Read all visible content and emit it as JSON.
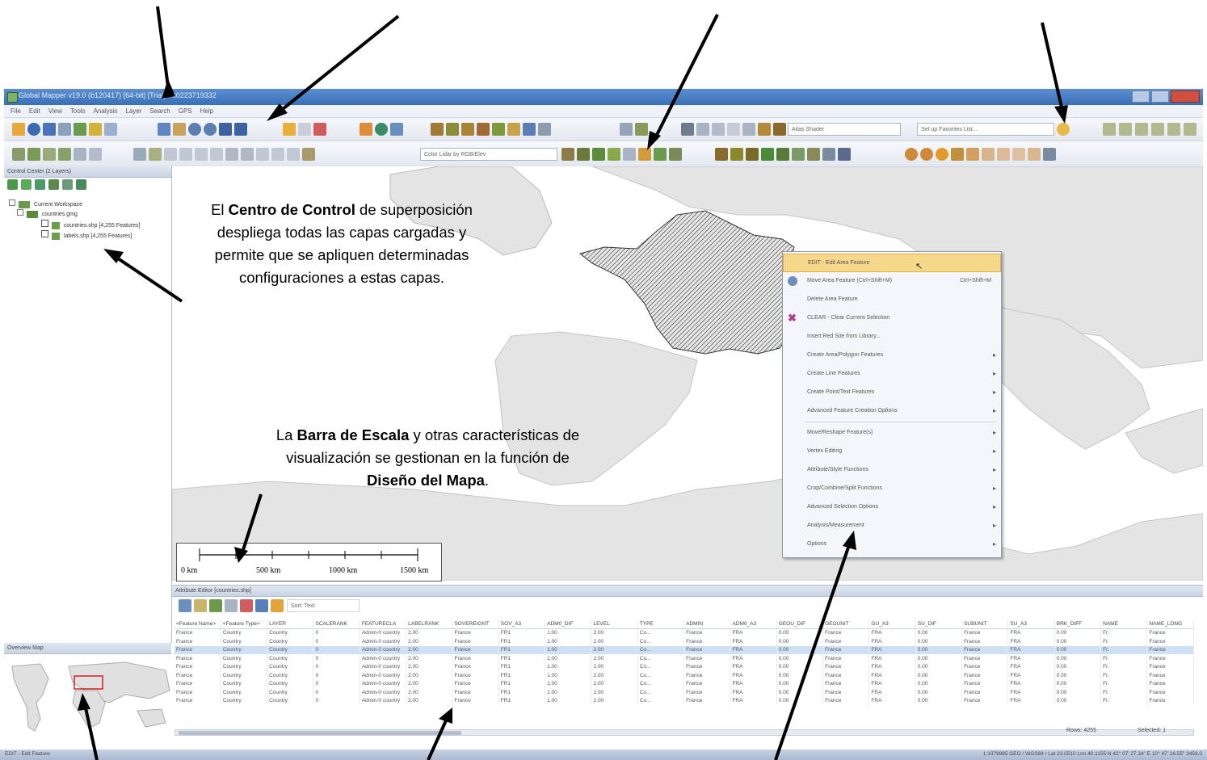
{
  "window": {
    "title": "Global Mapper v19.0 (b120417) [64-bit] [Trial] - 00223719332"
  },
  "menu": [
    "File",
    "Edit",
    "View",
    "Tools",
    "Analysis",
    "Layer",
    "Search",
    "GPS",
    "Help"
  ],
  "toolbars": {
    "shader_combo": "Atlas Shader",
    "favorites_combo": "Set up Favorites List...",
    "color_combo": "Color Lidar by RGB/Elev"
  },
  "control_center": {
    "title": "Control Center (2 Layers)",
    "tree": {
      "root": "Current Workspace",
      "group": "countries.gmg",
      "layers": [
        "countries.shp [4,255 Features]",
        "labels.shp [4,255 Features]"
      ]
    }
  },
  "annotations": {
    "control_center_note": {
      "pre": "El ",
      "bold": "Centro de Control",
      "post": " de superposición despliega todas las capas cargadas y permite que se apliquen determinadas configuraciones a estas capas."
    },
    "scale_bar_note": {
      "pre": "La ",
      "bold1": "Barra de Escala",
      "mid": " y otras características de visualización se gestionan en la función de ",
      "bold2": "Diseño del Mapa",
      "post": "."
    }
  },
  "scale_bar": {
    "labels": [
      "0 km",
      "500 km",
      "1000 km",
      "1500 km"
    ]
  },
  "context_menu": {
    "items": [
      {
        "label": "EDIT - Edit Area Feature",
        "highlight": true
      },
      {
        "label": "Move Area Feature (Ctrl+Shift+M)",
        "shortcut": "Ctrl+Shift+M"
      },
      {
        "label": "Delete Area Feature"
      },
      {
        "label": "CLEAR - Clear Current Selection"
      },
      {
        "label": "Insert Red Site from Library..."
      },
      {
        "label": "Create Area/Polygon Features",
        "submenu": true
      },
      {
        "label": "Create Line Features",
        "submenu": true
      },
      {
        "label": "Create Point/Text Features",
        "submenu": true
      },
      {
        "label": "Advanced Feature Creation Options",
        "submenu": true
      },
      {
        "label": "Move/Reshape Feature(s)",
        "submenu": true
      },
      {
        "label": "Vertex Editing",
        "submenu": true
      },
      {
        "label": "Attribute/Style Functions",
        "submenu": true
      },
      {
        "label": "Crop/Combine/Split Functions",
        "submenu": true
      },
      {
        "label": "Advanced Selection Options",
        "submenu": true
      },
      {
        "label": "Analysis/Measurement",
        "submenu": true
      },
      {
        "label": "Options",
        "submenu": true
      }
    ]
  },
  "attribute_editor": {
    "title": "Attribute Editor [countries.shp]",
    "sort_label": "Sort: Text",
    "columns": [
      "<Feature Name>",
      "<Feature Type>",
      "LAYER",
      "SCALERANK",
      "FEATURECLA",
      "LABELRANK",
      "SOVEREIGNT",
      "SOV_A3",
      "ADM0_DIF",
      "LEVEL",
      "TYPE",
      "ADMIN",
      "ADM0_A3",
      "GEOU_DIF",
      "GEOUNIT",
      "GU_A3",
      "SU_DIF",
      "SUBUNIT",
      "SU_A3",
      "BRK_DIFF",
      "NAME",
      "NAME_LONG"
    ],
    "row": [
      "France",
      "Country",
      "Country",
      "0",
      "Admin-0 country",
      "2.00",
      "France",
      "FR1",
      "1.00",
      "2.00",
      "Co...",
      "France",
      "FRA",
      "0.00",
      "France",
      "FRA",
      "0.00",
      "France",
      "FRA",
      "0.00",
      "Fr.",
      "France"
    ],
    "row_count": 9,
    "selected_row": 2,
    "rows_label": "Rows: 4255",
    "selected_label": "Selected: 1"
  },
  "overview": {
    "title": "Overview Map"
  },
  "statusbar": {
    "left": "EDIT - Edit Feature",
    "right": "1:1079985 GEO / WGS84 / Lat 23.0510  Lon 40.1155  N 42° 07' 27.34\" E 10° 47' 16.55\" 3459.0"
  }
}
